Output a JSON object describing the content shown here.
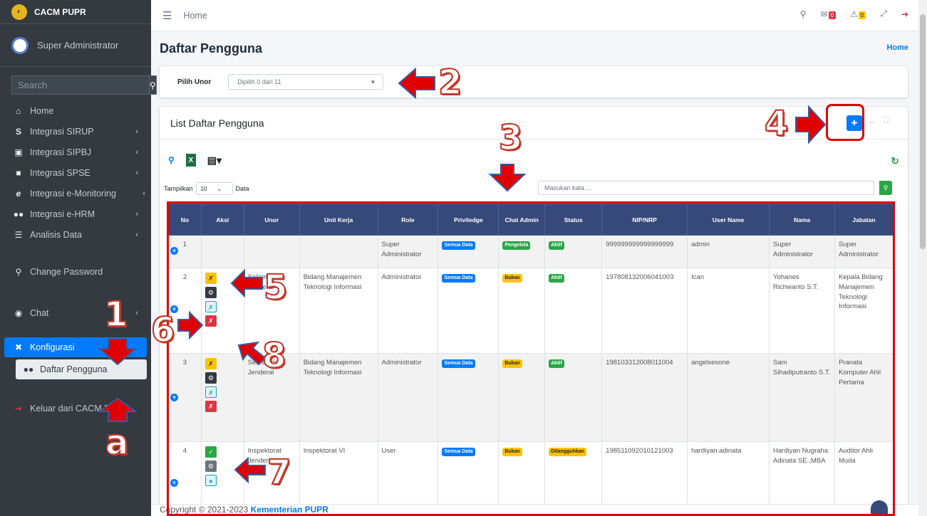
{
  "sidebar": {
    "brand": "CACM PUPR",
    "user": "Super Administrator",
    "search_placeholder": "Search",
    "items": [
      {
        "label": "Home",
        "icon": "home-icon"
      },
      {
        "label": "Integrasi SIRUP",
        "icon": "dollar-icon"
      },
      {
        "label": "Integrasi SIPBJ",
        "icon": "cart-icon"
      },
      {
        "label": "Integrasi SPSE",
        "icon": "building-icon"
      },
      {
        "label": "Integrasi e-Monitoring",
        "icon": "edge-icon"
      },
      {
        "label": "Integrasi e-HRM",
        "icon": "users-icon"
      },
      {
        "label": "Analisis Data",
        "icon": "database-icon"
      },
      {
        "label": "Change Password",
        "icon": "key-icon"
      },
      {
        "label": "Chat",
        "icon": "chat-icon"
      },
      {
        "label": "Konfigurasi",
        "icon": "tools-icon"
      },
      {
        "label": "Daftar Pengguna",
        "icon": "users-icon"
      },
      {
        "label": "Keluar dari CACM PUPR",
        "icon": "logout-icon"
      }
    ]
  },
  "topbar": {
    "breadcrumb": "Home",
    "badge_messages": "0",
    "badge_notifications": "0"
  },
  "page": {
    "title": "Daftar Pengguna",
    "crumb": "Home"
  },
  "filter": {
    "label": "Pilih Unor",
    "select_value": "Dipilih 0 dari 11"
  },
  "list": {
    "title": "List Daftar Pengguna",
    "length_prefix": "Tampilkan",
    "length_value": "10",
    "length_suffix": "Data",
    "search_placeholder": "Masukan kata ..."
  },
  "table": {
    "headers": [
      "No",
      "Aksi",
      "Unor",
      "Unit Kerja",
      "Role",
      "Priviledge",
      "Chat Admin",
      "Status",
      "NIP/NRP",
      "User Name",
      "Nama",
      "Jabatan"
    ],
    "rows": [
      {
        "no": "1",
        "unor": "",
        "unit_kerja": "",
        "role": "Super Administrator",
        "priviledge": "Semua Data",
        "chat_admin": "Pengelola",
        "status": "Aktif",
        "nip": "999999999999999999",
        "username": "admin",
        "nama": "Super Administrator",
        "jabatan": "Super Administrator"
      },
      {
        "no": "2",
        "unor": "Sekretariat Jenderal",
        "unit_kerja": "Bidang Manajemen Teknologi Informasi",
        "role": "Administrator",
        "priviledge": "Semua Data",
        "chat_admin": "Bukan",
        "status": "Aktif",
        "nip": "197808132006041003",
        "username": "Ican",
        "nama": "Yohanes Richwanto S.T.",
        "jabatan": "Kepala Bidang Manajemen Teknologi Informasi"
      },
      {
        "no": "3",
        "unor": "Sekretariat Jenderal",
        "unit_kerja": "Bidang Manajemen Teknologi Informasi",
        "role": "Administrator",
        "priviledge": "Semua Data",
        "chat_admin": "Bukan",
        "status": "Aktif",
        "nip": "198103312008011004",
        "username": "angelxesone",
        "nama": "Sam Sihadiputranto S.T.",
        "jabatan": "Pranata Komputer Ahli Pertama"
      },
      {
        "no": "4",
        "unor": "Inspektorat Jenderal",
        "unit_kerja": "Inspektorat VI",
        "role": "User",
        "priviledge": "Semua Data",
        "chat_admin": "Bukan",
        "status": "Ditangguhkan",
        "nip": "198511092010121003",
        "username": "hardiyan.adinata",
        "nama": "Hardiyan Nugraha Adinata SE.,MBA",
        "jabatan": "Auditor Ahli Muda"
      }
    ]
  },
  "footer": {
    "copyright": "Copyright © 2021-2023",
    "org": "Kementerian PUPR"
  },
  "annotations": [
    "1",
    "2",
    "3",
    "4",
    "5",
    "6",
    "7",
    "8",
    "a"
  ],
  "colors": {
    "accent": "#007bff",
    "sidebar": "#343a40",
    "table_header": "#37497a",
    "annotation": "#e00000"
  }
}
